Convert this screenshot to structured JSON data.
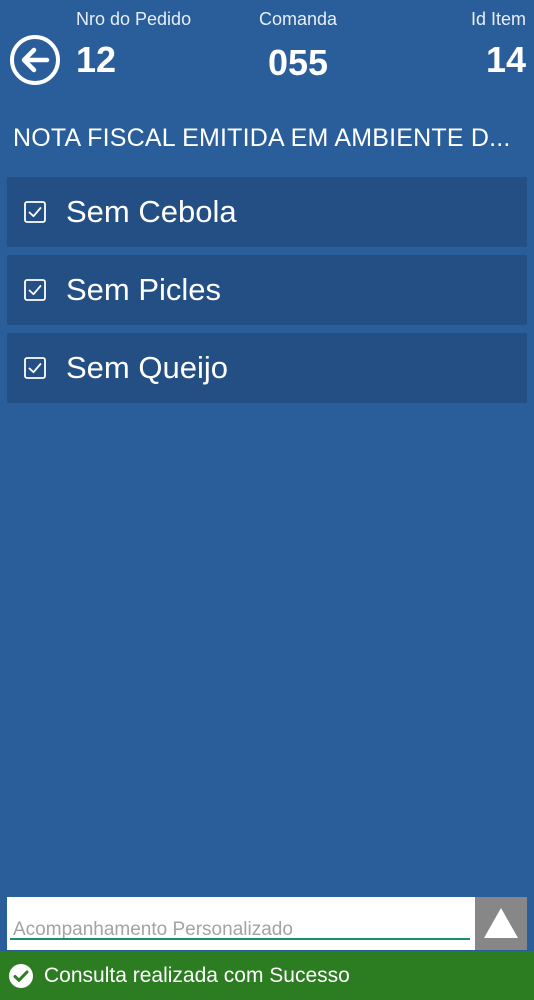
{
  "header": {
    "back_icon": "arrow-left-circle-icon",
    "pedido_label": "Nro do Pedido",
    "pedido_value": "12",
    "comanda_label": "Comanda",
    "comanda_value": "055",
    "item_label": "Id Item",
    "item_value": "14"
  },
  "nota_fiscal_title": "NOTA FISCAL EMITIDA EM AMBIENTE D...",
  "options": [
    {
      "label": "Sem Cebola",
      "checked": true
    },
    {
      "label": "Sem Picles",
      "checked": true
    },
    {
      "label": "Sem Queijo",
      "checked": true
    }
  ],
  "footer": {
    "input_placeholder": "Acompanhamento Personalizado",
    "input_value": "",
    "send_icon": "triangle-up-icon"
  },
  "status": {
    "icon": "check-circle-icon",
    "text": "Consulta realizada com Sucesso"
  },
  "colors": {
    "background": "#2a5e9b",
    "option_bg": "#234f85",
    "status_bg": "#2c7c22",
    "input_underline": "#1d8e6d",
    "send_btn_bg": "#878787"
  }
}
